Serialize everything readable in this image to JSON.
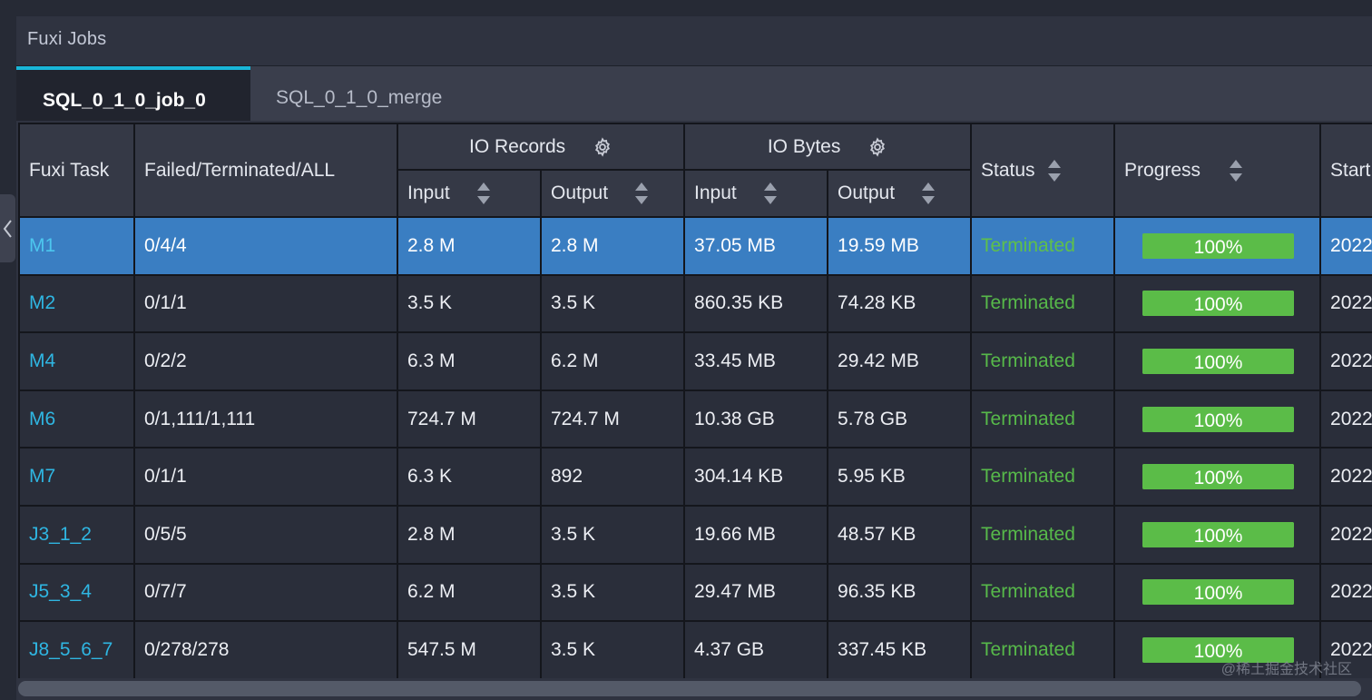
{
  "panel": {
    "title": "Fuxi Jobs"
  },
  "tabs": [
    {
      "label": "SQL_0_1_0_job_0",
      "active": true
    },
    {
      "label": "SQL_0_1_0_merge",
      "active": false
    }
  ],
  "table": {
    "headers": {
      "task": "Fuxi Task",
      "counts": "Failed/Terminated/ALL",
      "io_records": "IO Records",
      "io_bytes": "IO Bytes",
      "input": "Input",
      "output": "Output",
      "status": "Status",
      "progress": "Progress",
      "start": "Start"
    },
    "rows": [
      {
        "task": "M1",
        "counts": "0/4/4",
        "rec_in": "2.8 M",
        "rec_out": "2.8 M",
        "bytes_in": "37.05 MB",
        "bytes_out": "19.59 MB",
        "status": "Terminated",
        "progress": "100%",
        "start": "2022"
      },
      {
        "task": "M2",
        "counts": "0/1/1",
        "rec_in": "3.5 K",
        "rec_out": "3.5 K",
        "bytes_in": "860.35 KB",
        "bytes_out": "74.28 KB",
        "status": "Terminated",
        "progress": "100%",
        "start": "2022"
      },
      {
        "task": "M4",
        "counts": "0/2/2",
        "rec_in": "6.3 M",
        "rec_out": "6.2 M",
        "bytes_in": "33.45 MB",
        "bytes_out": "29.42 MB",
        "status": "Terminated",
        "progress": "100%",
        "start": "2022"
      },
      {
        "task": "M6",
        "counts": "0/1,111/1,111",
        "rec_in": "724.7 M",
        "rec_out": "724.7 M",
        "bytes_in": "10.38 GB",
        "bytes_out": "5.78 GB",
        "status": "Terminated",
        "progress": "100%",
        "start": "2022"
      },
      {
        "task": "M7",
        "counts": "0/1/1",
        "rec_in": "6.3 K",
        "rec_out": "892",
        "bytes_in": "304.14 KB",
        "bytes_out": "5.95 KB",
        "status": "Terminated",
        "progress": "100%",
        "start": "2022"
      },
      {
        "task": "J3_1_2",
        "counts": "0/5/5",
        "rec_in": "2.8 M",
        "rec_out": "3.5 K",
        "bytes_in": "19.66 MB",
        "bytes_out": "48.57 KB",
        "status": "Terminated",
        "progress": "100%",
        "start": "2022"
      },
      {
        "task": "J5_3_4",
        "counts": "0/7/7",
        "rec_in": "6.2 M",
        "rec_out": "3.5 K",
        "bytes_in": "29.47 MB",
        "bytes_out": "96.35 KB",
        "status": "Terminated",
        "progress": "100%",
        "start": "2022"
      },
      {
        "task": "J8_5_6_7",
        "counts": "0/278/278",
        "rec_in": "547.5 M",
        "rec_out": "3.5 K",
        "bytes_in": "4.37 GB",
        "bytes_out": "337.45 KB",
        "status": "Terminated",
        "progress": "100%",
        "start": "2022"
      }
    ],
    "progress_values": [
      100,
      100,
      100,
      100,
      100,
      100,
      100,
      100
    ]
  },
  "watermark": "@稀土掘金技术社区",
  "colors": {
    "accent": "#19b6d8",
    "task_link": "#2fb6e2",
    "status_ok": "#57b94a",
    "selected_row": "#3a7ec2",
    "progress": "#5bbc48"
  }
}
